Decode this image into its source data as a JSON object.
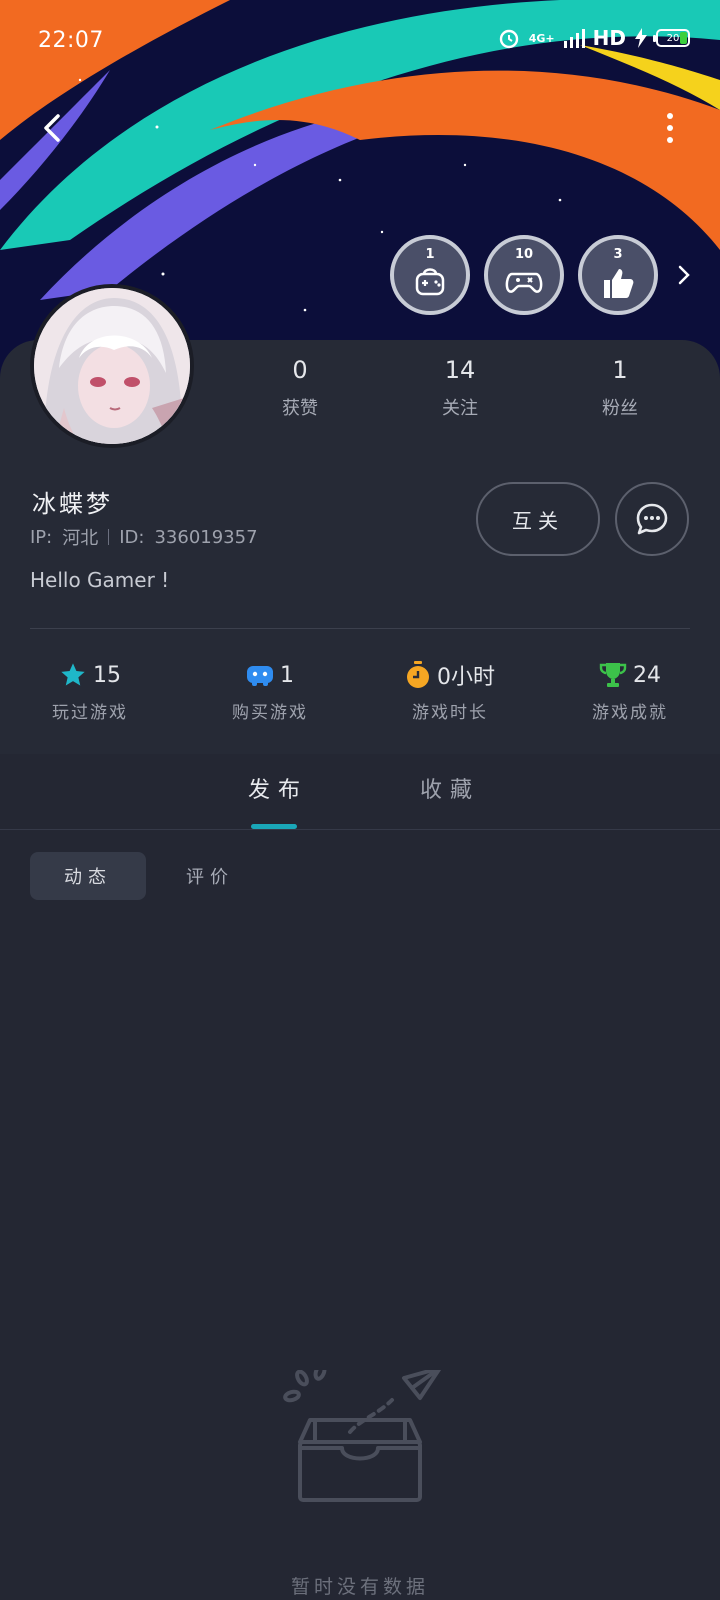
{
  "status_bar": {
    "time": "22:07",
    "network": "4G+",
    "hd": "HD",
    "battery": "20"
  },
  "badges": [
    {
      "num": "1",
      "sub": "Ꮝ▯▯▯▯▯"
    },
    {
      "num": "10",
      "sub": "Ꮝ▯▯▯▯▯"
    },
    {
      "num": "3",
      "sub": "Ꮝ▯▯▯▯▯"
    }
  ],
  "profile": {
    "stats": [
      {
        "value": "0",
        "label": "获赞"
      },
      {
        "value": "14",
        "label": "关注"
      },
      {
        "value": "1",
        "label": "粉丝"
      }
    ],
    "username": "冰蝶梦",
    "ip_label": "IP:",
    "ip_value": "河北",
    "id_label": "ID:",
    "id_value": "336019357",
    "bio": "Hello Gamer !",
    "mutual_label": "互关"
  },
  "game_stats": [
    {
      "value": "15",
      "label": "玩过游戏",
      "icon": "star-icon",
      "color": "#1fb7c9"
    },
    {
      "value": "1",
      "label": "购买游戏",
      "icon": "gamepad-icon",
      "color": "#2f8cf0"
    },
    {
      "value": "0小时",
      "label": "游戏时长",
      "icon": "stopwatch-icon",
      "color": "#f5a623"
    },
    {
      "value": "24",
      "label": "游戏成就",
      "icon": "trophy-icon",
      "color": "#3cc24a"
    }
  ],
  "tabs": [
    {
      "label": "发布"
    },
    {
      "label": "收藏"
    }
  ],
  "subtabs": [
    {
      "label": "动态"
    },
    {
      "label": "评价"
    }
  ],
  "empty_state": {
    "text": "暂时没有数据"
  }
}
